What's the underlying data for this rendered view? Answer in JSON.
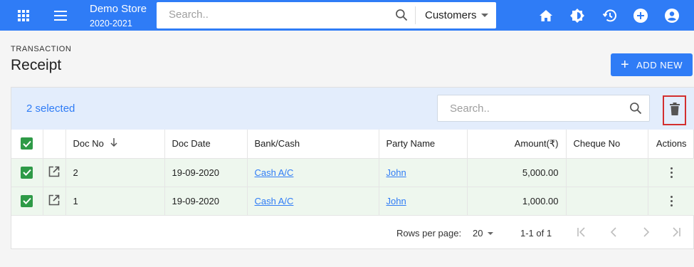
{
  "topbar": {
    "store_name": "Demo Store",
    "store_year": "2020-2021",
    "search_placeholder": "Search..",
    "search_scope": "Customers",
    "icons": [
      "apps-icon",
      "menu-icon",
      "home-icon",
      "brightness-icon",
      "history-icon",
      "add-circle-icon",
      "account-icon"
    ]
  },
  "page": {
    "breadcrumb": "TRANSACTION",
    "title": "Receipt",
    "add_new_label": "ADD NEW"
  },
  "table": {
    "selected_text": "2 selected",
    "search_placeholder": "Search..",
    "columns": {
      "doc_no": "Doc No",
      "doc_date": "Doc Date",
      "bank_cash": "Bank/Cash",
      "party_name": "Party Name",
      "amount": "Amount(₹)",
      "cheque_no": "Cheque No",
      "actions": "Actions"
    },
    "rows": [
      {
        "doc_no": "2",
        "doc_date": "19-09-2020",
        "bank_cash": "Cash A/C",
        "party_name": "John",
        "amount": "5,000.00",
        "cheque_no": ""
      },
      {
        "doc_no": "1",
        "doc_date": "19-09-2020",
        "bank_cash": "Cash A/C",
        "party_name": "John",
        "amount": "1,000.00",
        "cheque_no": ""
      }
    ]
  },
  "pagination": {
    "rows_per_page_label": "Rows per page:",
    "rows_per_page_value": "20",
    "range_text": "1-1 of 1"
  },
  "colors": {
    "accent": "#2f7cf6",
    "selection_bar": "#e3edfc",
    "checkbox": "#2e9a47",
    "row_selected": "#eef7ee",
    "delete_highlight": "#d32f2f"
  }
}
